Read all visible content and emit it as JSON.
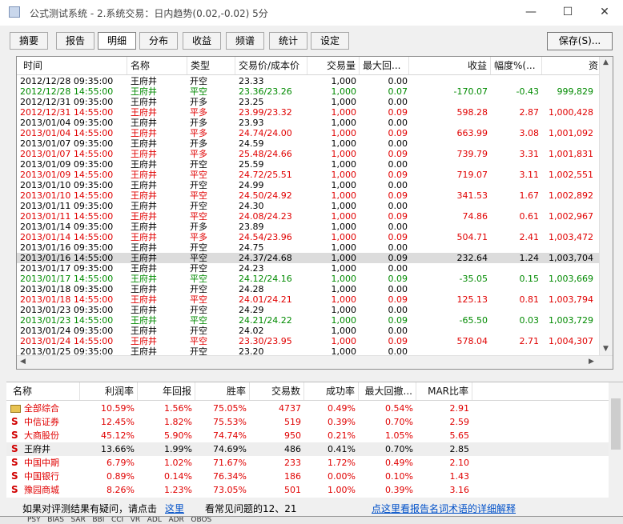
{
  "window": {
    "title": "公式测试系统 - 2.系统交易：日内趋势(0.02,-0.02) 5分",
    "min_glyph": "—",
    "max_glyph": "☐",
    "close_glyph": "✕"
  },
  "toolbar": {
    "tabs": [
      "摘要",
      "报告",
      "明细",
      "分布",
      "收益",
      "频谱",
      "统计",
      "设定"
    ],
    "active": "明细",
    "save_label": "保存(S)..."
  },
  "trades": {
    "columns": [
      "时间",
      "名称",
      "类型",
      "交易价/成本价",
      "交易量",
      "最大回...",
      "收益",
      "幅度%(...",
      "资"
    ],
    "rows": [
      [
        "2012/12/28 09:35:00",
        "王府井",
        "开空",
        "23.33",
        "1,000",
        "0.00",
        "",
        "",
        ""
      ],
      [
        "2012/12/28 14:55:00",
        "王府井",
        "平空",
        "23.36/23.26",
        "1,000",
        "0.07",
        "-170.07",
        "-0.43",
        "999,829"
      ],
      [
        "2012/12/31 09:35:00",
        "王府井",
        "开多",
        "23.25",
        "1,000",
        "0.00",
        "",
        "",
        ""
      ],
      [
        "2012/12/31 14:55:00",
        "王府井",
        "平多",
        "23.99/23.32",
        "1,000",
        "0.09",
        "598.28",
        "2.87",
        "1,000,428"
      ],
      [
        "2013/01/04 09:35:00",
        "王府井",
        "开多",
        "23.93",
        "1,000",
        "0.00",
        "",
        "",
        ""
      ],
      [
        "2013/01/04 14:55:00",
        "王府井",
        "平多",
        "24.74/24.00",
        "1,000",
        "0.09",
        "663.99",
        "3.08",
        "1,001,092"
      ],
      [
        "2013/01/07 09:35:00",
        "王府井",
        "开多",
        "24.59",
        "1,000",
        "0.00",
        "",
        "",
        ""
      ],
      [
        "2013/01/07 14:55:00",
        "王府井",
        "平多",
        "25.48/24.66",
        "1,000",
        "0.09",
        "739.79",
        "3.31",
        "1,001,831"
      ],
      [
        "2013/01/09 09:35:00",
        "王府井",
        "开空",
        "25.59",
        "1,000",
        "0.00",
        "",
        "",
        ""
      ],
      [
        "2013/01/09 14:55:00",
        "王府井",
        "平空",
        "24.72/25.51",
        "1,000",
        "0.09",
        "719.07",
        "3.11",
        "1,002,551"
      ],
      [
        "2013/01/10 09:35:00",
        "王府井",
        "开空",
        "24.99",
        "1,000",
        "0.00",
        "",
        "",
        ""
      ],
      [
        "2013/01/10 14:55:00",
        "王府井",
        "平空",
        "24.50/24.92",
        "1,000",
        "0.09",
        "341.53",
        "1.67",
        "1,002,892"
      ],
      [
        "2013/01/11 09:35:00",
        "王府井",
        "开空",
        "24.30",
        "1,000",
        "0.00",
        "",
        "",
        ""
      ],
      [
        "2013/01/11 14:55:00",
        "王府井",
        "平空",
        "24.08/24.23",
        "1,000",
        "0.09",
        "74.86",
        "0.61",
        "1,002,967"
      ],
      [
        "2013/01/14 09:35:00",
        "王府井",
        "开多",
        "23.89",
        "1,000",
        "0.00",
        "",
        "",
        ""
      ],
      [
        "2013/01/14 14:55:00",
        "王府井",
        "平多",
        "24.54/23.96",
        "1,000",
        "0.09",
        "504.71",
        "2.41",
        "1,003,472"
      ],
      [
        "2013/01/16 09:35:00",
        "王府井",
        "开空",
        "24.75",
        "1,000",
        "0.00",
        "",
        "",
        ""
      ],
      [
        "2013/01/16 14:55:00",
        "王府井",
        "平空",
        "24.37/24.68",
        "1,000",
        "0.09",
        "232.64",
        "1.24",
        "1,003,704"
      ],
      [
        "2013/01/17 09:35:00",
        "王府井",
        "开空",
        "24.23",
        "1,000",
        "0.00",
        "",
        "",
        ""
      ],
      [
        "2013/01/17 14:55:00",
        "王府井",
        "平空",
        "24.12/24.16",
        "1,000",
        "0.09",
        "-35.05",
        "0.15",
        "1,003,669"
      ],
      [
        "2013/01/18 09:35:00",
        "王府井",
        "开空",
        "24.28",
        "1,000",
        "0.00",
        "",
        "",
        ""
      ],
      [
        "2013/01/18 14:55:00",
        "王府井",
        "平空",
        "24.01/24.21",
        "1,000",
        "0.09",
        "125.13",
        "0.81",
        "1,003,794"
      ],
      [
        "2013/01/23 09:35:00",
        "王府井",
        "开空",
        "24.29",
        "1,000",
        "0.00",
        "",
        "",
        ""
      ],
      [
        "2013/01/23 14:55:00",
        "王府井",
        "平空",
        "24.21/24.22",
        "1,000",
        "0.09",
        "-65.50",
        "0.03",
        "1,003,729"
      ],
      [
        "2013/01/24 09:35:00",
        "王府井",
        "开空",
        "24.02",
        "1,000",
        "0.00",
        "",
        "",
        ""
      ],
      [
        "2013/01/24 14:55:00",
        "王府井",
        "平空",
        "23.30/23.95",
        "1,000",
        "0.09",
        "578.04",
        "2.71",
        "1,004,307"
      ],
      [
        "2013/01/25 09:35:00",
        "王府井",
        "开空",
        "23.20",
        "1,000",
        "0.00",
        "",
        "",
        ""
      ]
    ],
    "row_colors": [
      "k",
      "g",
      "k",
      "r",
      "k",
      "r",
      "k",
      "r",
      "k",
      "r",
      "k",
      "r",
      "k",
      "r",
      "k",
      "r",
      "k",
      "k",
      "k",
      "g",
      "k",
      "r",
      "k",
      "g",
      "k",
      "r",
      "k"
    ],
    "selected_row": 17
  },
  "summary": {
    "columns": [
      "名称",
      "利润率",
      "年回报",
      "胜率",
      "交易数",
      "成功率",
      "最大回撤...",
      "MAR比率"
    ],
    "rows": [
      [
        "全部综合",
        "10.59%",
        "1.56%",
        "75.05%",
        "4737",
        "0.49%",
        "0.54%",
        "2.91"
      ],
      [
        "中信证券",
        "12.45%",
        "1.82%",
        "75.53%",
        "519",
        "0.39%",
        "0.70%",
        "2.59"
      ],
      [
        "大商股份",
        "45.12%",
        "5.90%",
        "74.74%",
        "950",
        "0.21%",
        "1.05%",
        "5.65"
      ],
      [
        "王府井",
        "13.66%",
        "1.99%",
        "74.69%",
        "486",
        "0.41%",
        "0.70%",
        "2.85"
      ],
      [
        "中国中期",
        "6.79%",
        "1.02%",
        "71.67%",
        "233",
        "1.72%",
        "0.49%",
        "2.10"
      ],
      [
        "中国银行",
        "0.89%",
        "0.14%",
        "76.34%",
        "186",
        "0.00%",
        "0.10%",
        "1.43"
      ],
      [
        "豫园商城",
        "8.26%",
        "1.23%",
        "73.05%",
        "501",
        "1.00%",
        "0.39%",
        "3.16"
      ]
    ],
    "icons": [
      "folder",
      "S",
      "S",
      "S",
      "S",
      "S",
      "S"
    ],
    "row_colors": [
      "r",
      "r",
      "r",
      "k",
      "r",
      "r",
      "r"
    ],
    "selected_row": 3
  },
  "status": {
    "prompt": "如果对评测结果有疑问，请点击",
    "here_link": "这里",
    "faq_text": "看常见问题的12、21",
    "detail_link": "点这里看报告名词术语的详细解释"
  },
  "bottom_bar": {
    "text": "PSY   BIAS   SAR   BBI   CCI   VR   ADL   ADR   OBOS"
  },
  "colors": {
    "red": "#e00000",
    "green": "#008a00",
    "link": "#0050c8"
  }
}
